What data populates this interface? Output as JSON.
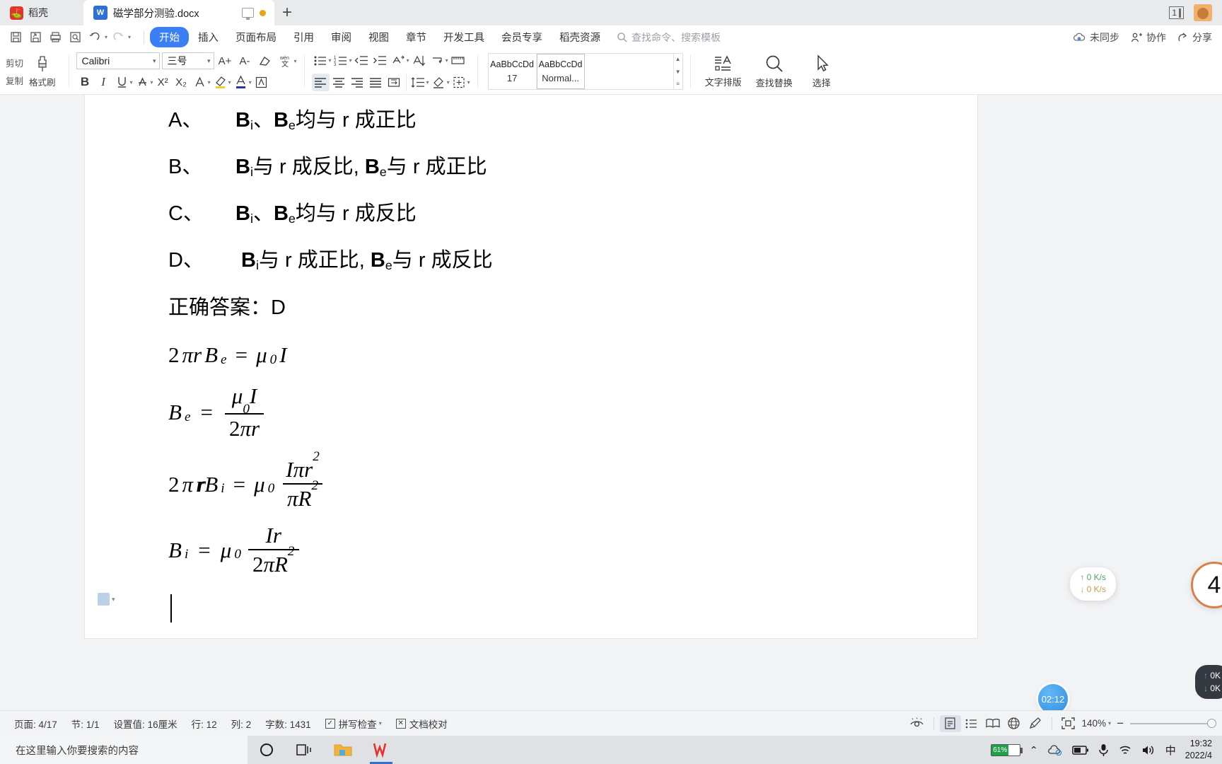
{
  "tabbar": {
    "kdocs_label": "稻壳",
    "kdocs_icon": "kdocs-logo-icon",
    "doc_tab_name": "磁学部分测验.docx",
    "doc_tab_icon": "wps-writer-icon",
    "monitor_icon": "monitor-icon",
    "status_dot_icon": "unsaved-dot-icon",
    "new_tab_label": "+",
    "window_count": "1",
    "avatar_icon": "user-avatar"
  },
  "quick_access": [
    {
      "name": "save-button",
      "glyph": "save-icon"
    },
    {
      "name": "save-as-button",
      "glyph": "save-as-icon"
    },
    {
      "name": "print-button",
      "glyph": "print-icon"
    },
    {
      "name": "print-preview-button",
      "glyph": "print-preview-icon"
    },
    {
      "name": "undo-button",
      "glyph": "undo-icon"
    },
    {
      "name": "redo-button",
      "glyph": "redo-icon"
    },
    {
      "name": "customize-qat-button",
      "glyph": "chevron-down-icon"
    }
  ],
  "menu": {
    "items": [
      {
        "label": "开始",
        "active": true
      },
      {
        "label": "插入",
        "active": false
      },
      {
        "label": "页面布局",
        "active": false
      },
      {
        "label": "引用",
        "active": false
      },
      {
        "label": "审阅",
        "active": false
      },
      {
        "label": "视图",
        "active": false
      },
      {
        "label": "章节",
        "active": false
      },
      {
        "label": "开发工具",
        "active": false
      },
      {
        "label": "会员专享",
        "active": false
      },
      {
        "label": "稻壳资源",
        "active": false
      }
    ],
    "search_placeholder": "查找命令、搜索模板",
    "right_items": [
      {
        "label": "未同步",
        "icon": "cloud-sync-icon"
      },
      {
        "label": "协作",
        "icon": "collaborate-icon"
      },
      {
        "label": "分享",
        "icon": "share-icon"
      }
    ]
  },
  "ribbon": {
    "clipboard": {
      "cut_label": "剪切",
      "copy_label": "复制",
      "format_painter_label": "格式刷"
    },
    "font": {
      "family_value": "Calibri",
      "size_value": "三号",
      "grow_font": "A+",
      "shrink_font": "A-",
      "clear_format_icon": "clear-format-icon",
      "pinyin_icon": "pinyin-guide-icon",
      "bold": "B",
      "italic": "I",
      "underline": "U",
      "strikethrough": "A",
      "superscript": "X²",
      "subscript": "X₂",
      "text_effect_icon": "text-effect-icon",
      "highlight_icon": "highlight-color-icon",
      "font_color_icon": "font-color-icon",
      "char_border_icon": "character-border-icon"
    },
    "paragraph": {
      "bullets_icon": "bullet-list-icon",
      "numbering_icon": "numbered-list-icon",
      "decrease_indent_icon": "decrease-indent-icon",
      "increase_indent_icon": "increase-indent-icon",
      "multilevel_icon": "multilevel-list-icon",
      "sort_icon": "sort-icon",
      "show_marks_icon": "show-paragraph-marks-icon",
      "ruler_icon": "ruler-icon",
      "align_left_icon": "align-left-icon",
      "align_center_icon": "align-center-icon",
      "align_right_icon": "align-right-icon",
      "justify_icon": "justify-icon",
      "distribute_icon": "distribute-icon",
      "line_spacing_icon": "line-spacing-icon",
      "shading_icon": "shading-icon",
      "borders_icon": "borders-icon"
    },
    "styles": [
      {
        "preview": "AaBbCcDd",
        "name": "17",
        "selected": false
      },
      {
        "preview": "AaBbCcDd",
        "name": "Normal...",
        "selected": true
      }
    ],
    "tools": [
      {
        "label": "文字排版",
        "icon": "text-layout-icon"
      },
      {
        "label": "查找替换",
        "icon": "find-replace-icon"
      },
      {
        "label": "选择",
        "icon": "select-arrow-icon"
      }
    ]
  },
  "document": {
    "options": [
      {
        "letter": "A、",
        "parts": [
          {
            "t": "B",
            "sub": "i"
          },
          {
            "t": "、"
          },
          {
            "t": "B",
            "sub": "e"
          },
          {
            "t": "均与 r 成正比"
          }
        ]
      },
      {
        "letter": "B、",
        "parts": [
          {
            "t": "B",
            "sub": "i"
          },
          {
            "t": "与 r 成反比, "
          },
          {
            "t": "B",
            "sub": "e"
          },
          {
            "t": "与 r 成正比"
          }
        ]
      },
      {
        "letter": "C、",
        "parts": [
          {
            "t": "B",
            "sub": "i"
          },
          {
            "t": "、"
          },
          {
            "t": "B",
            "sub": "e"
          },
          {
            "t": "均与 r 成反比"
          }
        ]
      },
      {
        "letter": "D、",
        "parts": [
          {
            "t": "B",
            "sub": "i"
          },
          {
            "t": "与 r 成正比, "
          },
          {
            "t": "B",
            "sub": "e"
          },
          {
            "t": "与 r 成反比"
          }
        ]
      }
    ],
    "answer_line": "正确答案：D",
    "formulas": [
      "2πrB_e = μ₀I",
      "B_e = μ₀I / 2πr",
      "2πr̈B_i = μ₀ · Iπr² / πR²",
      "B_i = μ₀ · Ir / 2πR²"
    ],
    "paragraph_mark_icon": "paragraph-layout-options-icon"
  },
  "statusbar": {
    "page": "页面: 4/17",
    "section": "节: 1/1",
    "setting": "设置值: 16厘米",
    "row": "行: 12",
    "col": "列: 2",
    "word_count": "字数: 1431",
    "spell_check": "拼写检查",
    "doc_proof": "文档校对",
    "view_icons": [
      {
        "name": "reading-eye-icon"
      },
      {
        "name": "print-layout-view-icon",
        "selected": true
      },
      {
        "name": "outline-view-icon"
      },
      {
        "name": "reading-view-icon"
      },
      {
        "name": "web-view-icon"
      },
      {
        "name": "edit-pen-icon"
      }
    ],
    "fit_icon": "fit-page-icon",
    "zoom_level": "140%",
    "zoom_out": "−",
    "zoom_in": "+"
  },
  "taskbar": {
    "search_placeholder": "在这里输入你要搜索的内容",
    "apps": [
      {
        "name": "cortana-icon"
      },
      {
        "name": "task-view-icon"
      },
      {
        "name": "file-explorer-icon"
      },
      {
        "name": "wps-office-icon"
      }
    ],
    "tray": {
      "battery_percent": "61%",
      "show_hidden_icon": "chevron-up-icon",
      "cloud_icon": "onedrive-sync-icon",
      "battery_icon": "battery-icon",
      "mic_icon": "microphone-icon",
      "wifi_icon": "wifi-icon",
      "volume_icon": "speaker-icon",
      "ime_label": "中",
      "time": "19:32",
      "date": "2022/4"
    }
  },
  "widgets": {
    "net_pill": {
      "up": "↑ 0  K/s",
      "down": "↓ 0  K/s"
    },
    "circle_badge": "4",
    "dark_pill": {
      "up": "0K",
      "down": "0K"
    },
    "timer_bubble": "02:12"
  }
}
